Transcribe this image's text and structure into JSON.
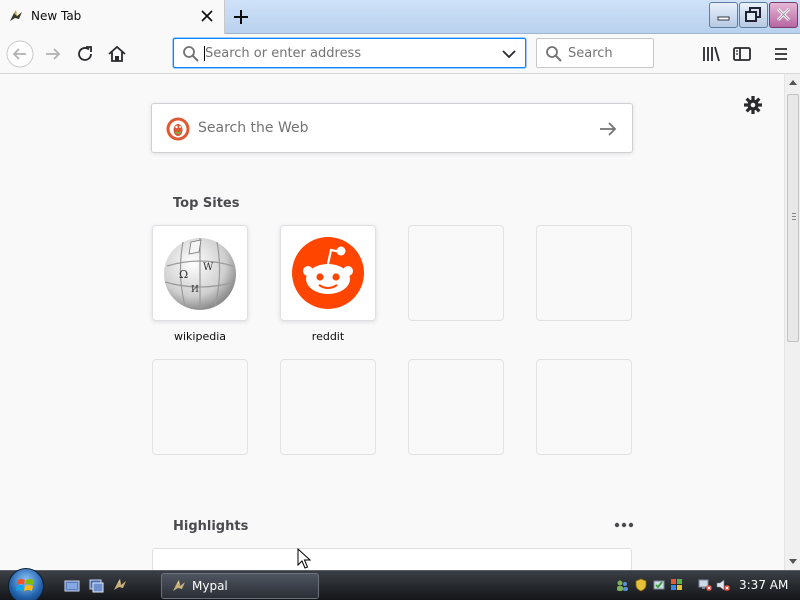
{
  "tabbar": {
    "tab_title": "New Tab"
  },
  "toolbar": {
    "url_placeholder": "Search or enter address",
    "search_placeholder": "Search"
  },
  "content": {
    "web_search_placeholder": "Search the Web",
    "top_sites_title": "Top Sites",
    "top_sites": [
      {
        "label": "wikipedia"
      },
      {
        "label": "reddit"
      }
    ],
    "highlights_title": "Highlights"
  },
  "taskbar": {
    "task_label": "Mypal",
    "clock": "3:37 AM"
  },
  "colors": {
    "accent": "#0a84ff",
    "reddit": "#ff4500",
    "duckduckgo": "#de5833"
  }
}
